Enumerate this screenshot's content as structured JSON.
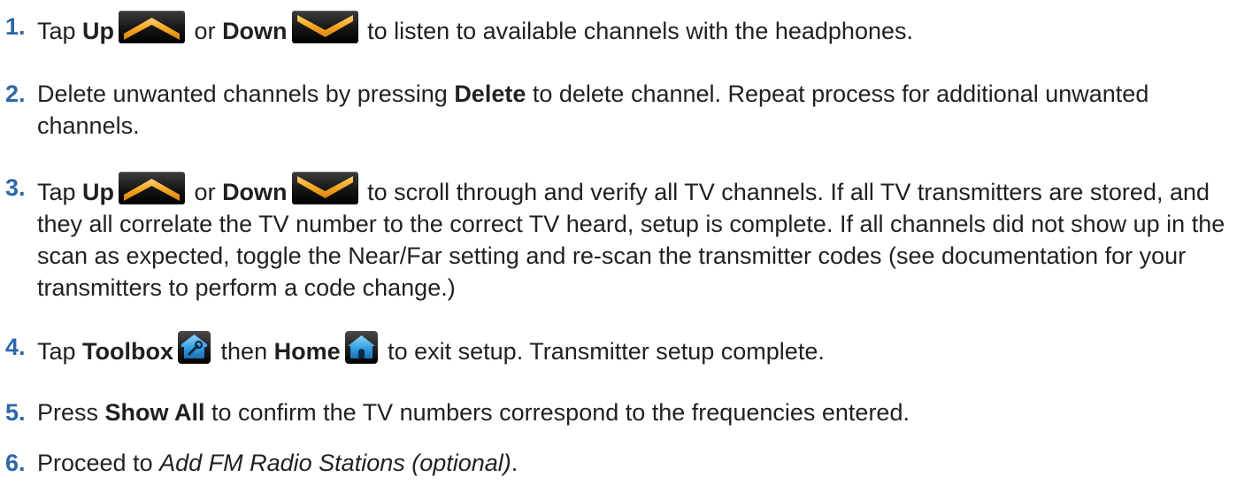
{
  "steps": [
    {
      "number": "1.",
      "t1": "Tap ",
      "b1": "Up",
      "t2": " or ",
      "b2": "Down",
      "t3": " to listen to available channels with the headphones."
    },
    {
      "number": "2.",
      "t1": "Delete unwanted channels by pressing ",
      "b1": "Delete",
      "t2": " to delete channel. Repeat process for additional unwanted channels."
    },
    {
      "number": "3.",
      "t1": "Tap ",
      "b1": "Up",
      "t2": " or ",
      "b2": "Down",
      "t3": " to scroll through and verify all TV channels. If all TV transmitters are stored, and they all correlate the TV number to the correct TV heard, setup is complete.  If all channels did not show up in the scan as expected, toggle the Near/Far setting and re-scan the transmitter codes (see documentation for your transmitters to perform a code change.)"
    },
    {
      "number": "4.",
      "t1": "Tap ",
      "b1": "Toolbox",
      "t2": " then ",
      "b2": "Home",
      "t3": " to exit setup. Transmitter setup complete."
    },
    {
      "number": "5.",
      "t1": "Press ",
      "b1": "Show All",
      "t2": " to confirm the TV numbers correspond to the frequencies entered."
    },
    {
      "number": "6.",
      "t1": "Proceed to ",
      "i1": "Add FM Radio Stations (optional)",
      "t2": "."
    }
  ],
  "icons": {
    "up": "chevron-up-icon",
    "down": "chevron-down-icon",
    "toolbox": "toolbox-icon",
    "home": "home-icon"
  },
  "colors": {
    "number": "#2d67a8",
    "text": "#231f20",
    "chevron": "#f5a623",
    "icon_blue": "#3ba7e0"
  }
}
